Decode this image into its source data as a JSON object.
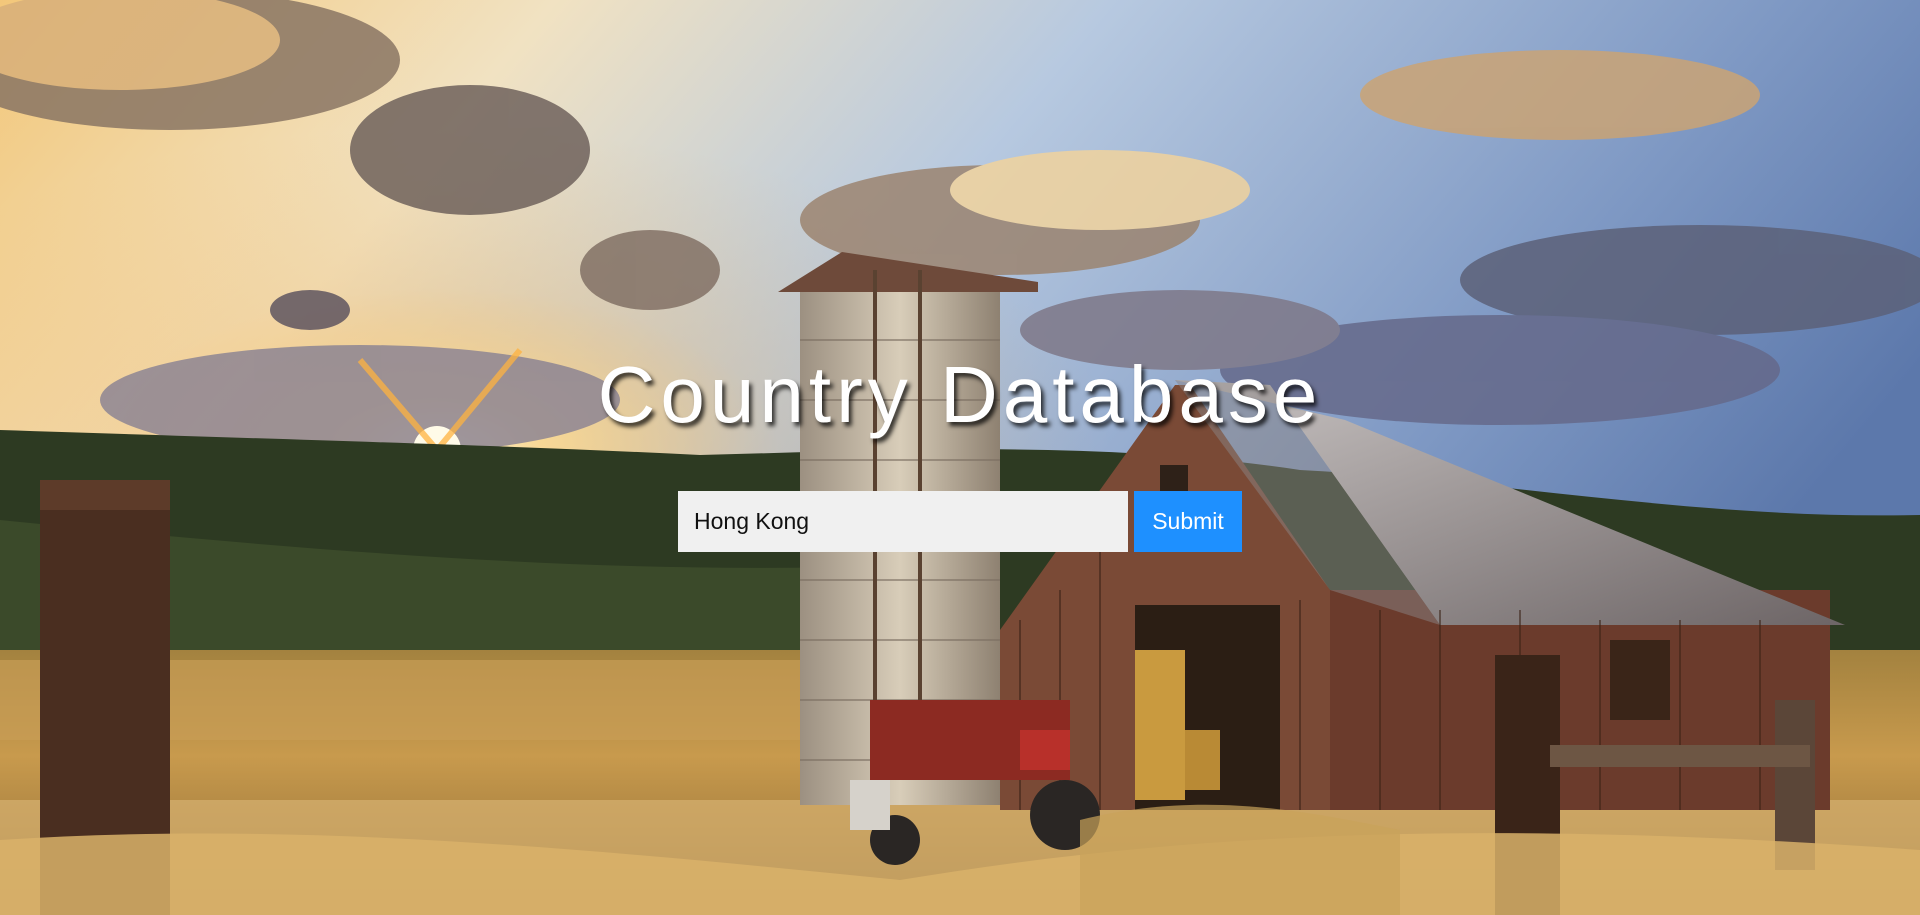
{
  "header": {
    "title": "Country Database"
  },
  "search": {
    "value": "Hong Kong",
    "submit_label": "Submit"
  },
  "colors": {
    "button": "#1e90ff",
    "input_bg": "#f0f0f0",
    "title": "#ffffff"
  }
}
